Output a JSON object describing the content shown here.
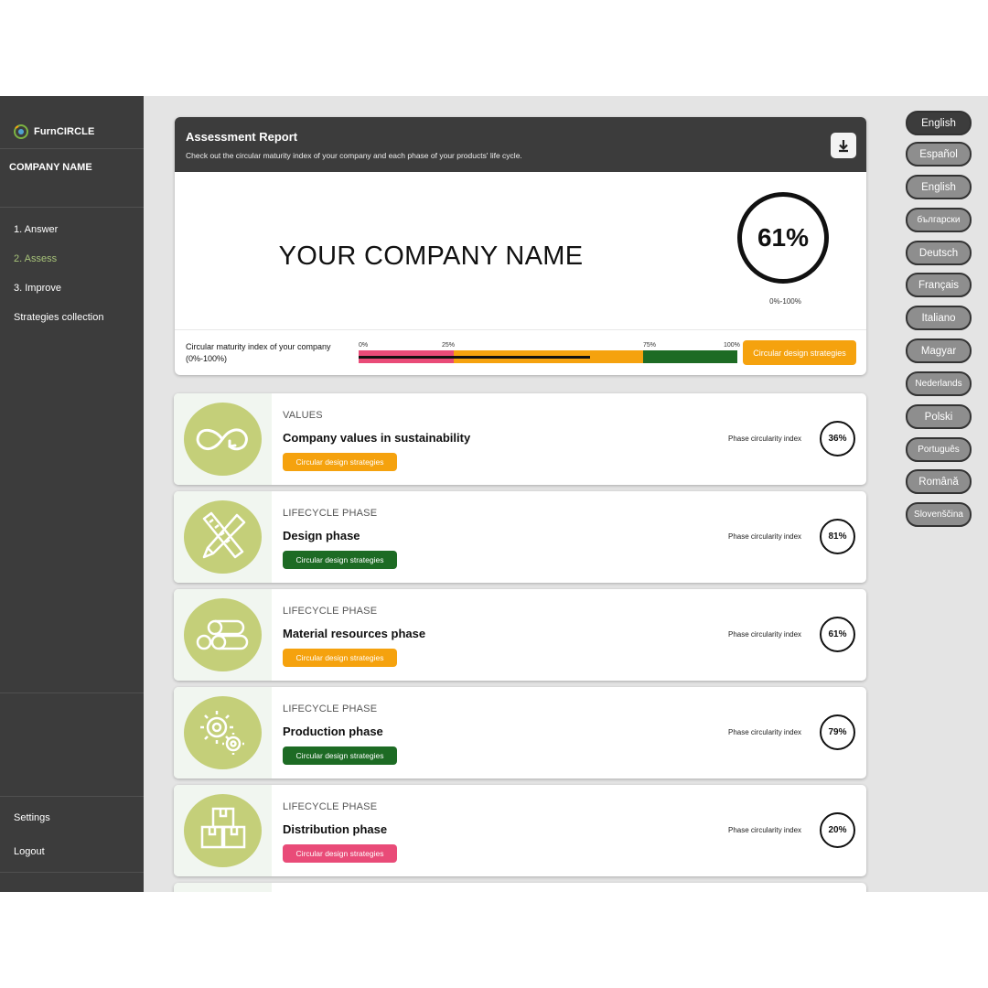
{
  "brand": {
    "name": "FurnCIRCLE"
  },
  "sidebar": {
    "company": "COMPANY NAME",
    "nav": [
      "1. Answer",
      "2. Assess",
      "3. Improve",
      "Strategies collection"
    ],
    "active_index": 1,
    "bottom": [
      "Settings",
      "Logout"
    ]
  },
  "report": {
    "title": "Assessment Report",
    "subtitle": "Check out the circular maturity index of your company and each phase of your products' life cycle.",
    "company_name": "YOUR COMPANY NAME",
    "overall_index": "61%",
    "overall_value": 61,
    "range_label": "0%-100%",
    "maturity_label": "Circular maturity index of your company (0%-100%)",
    "ticks": [
      "0%",
      "25%",
      "75%",
      "100%"
    ],
    "strategies_button": "Circular design strategies"
  },
  "phases": [
    {
      "category": "VALUES",
      "title": "Company values in sustainability",
      "button": "Circular design strategies",
      "index_label": "Phase circularity index",
      "index": "36%",
      "button_color": "#f5a20e",
      "icon": "infinity-arrow-icon"
    },
    {
      "category": "LIFECYCLE PHASE",
      "title": "Design phase",
      "button": "Circular design strategies",
      "index_label": "Phase circularity index",
      "index": "81%",
      "button_color": "#1d6b24",
      "icon": "pencil-ruler-icon"
    },
    {
      "category": "LIFECYCLE PHASE",
      "title": "Material resources phase",
      "button": "Circular design strategies",
      "index_label": "Phase circularity index",
      "index": "61%",
      "button_color": "#f5a20e",
      "icon": "logs-icon"
    },
    {
      "category": "LIFECYCLE PHASE",
      "title": "Production phase",
      "button": "Circular design strategies",
      "index_label": "Phase circularity index",
      "index": "79%",
      "button_color": "#1d6b24",
      "icon": "gears-icon"
    },
    {
      "category": "LIFECYCLE PHASE",
      "title": "Distribution phase",
      "button": "Circular design strategies",
      "index_label": "Phase circularity index",
      "index": "20%",
      "button_color": "#e94b78",
      "icon": "boxes-icon"
    }
  ],
  "languages": [
    "English",
    "Español",
    "English",
    "български",
    "Deutsch",
    "Français",
    "Italiano",
    "Magyar",
    "Nederlands",
    "Polski",
    "Português",
    "Română",
    "Slovenščina"
  ],
  "colors": {
    "sidebar": "#3c3c3c",
    "accent_green": "#a8c47a",
    "red": "#e94b78",
    "orange": "#f5a20e",
    "green": "#1d6b24",
    "icon_bg": "#c4cf79"
  }
}
